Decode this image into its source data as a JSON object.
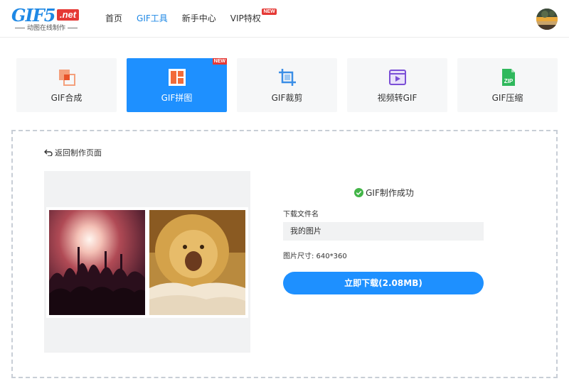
{
  "logo": {
    "main": "GIF5",
    "net": ".net",
    "tagline": "动图在线制作"
  },
  "nav": {
    "items": [
      {
        "label": "首页"
      },
      {
        "label": "GIF工具"
      },
      {
        "label": "新手中心"
      },
      {
        "label": "VIP特权",
        "badge": "NEW"
      }
    ],
    "active_index": 1
  },
  "tools": {
    "items": [
      {
        "label": "GIF合成",
        "icon": "gif-merge-icon"
      },
      {
        "label": "GIF拼图",
        "icon": "gif-puzzle-icon",
        "badge": "NEW"
      },
      {
        "label": "GIF裁剪",
        "icon": "crop-icon"
      },
      {
        "label": "视频转GIF",
        "icon": "video-icon"
      },
      {
        "label": "GIF压缩",
        "icon": "zip-icon",
        "icon_text": "ZIP"
      }
    ],
    "active_index": 1
  },
  "work": {
    "back_label": "返回制作页面",
    "success_text": "GIF制作成功",
    "filename_label": "下载文件名",
    "filename_value": "我的图片",
    "size_text": "图片尺寸: 640*360",
    "download_label": "立即下载(2.08MB)"
  },
  "colors": {
    "accent": "#1e90ff",
    "badge": "#e53935",
    "success": "#43b548"
  }
}
